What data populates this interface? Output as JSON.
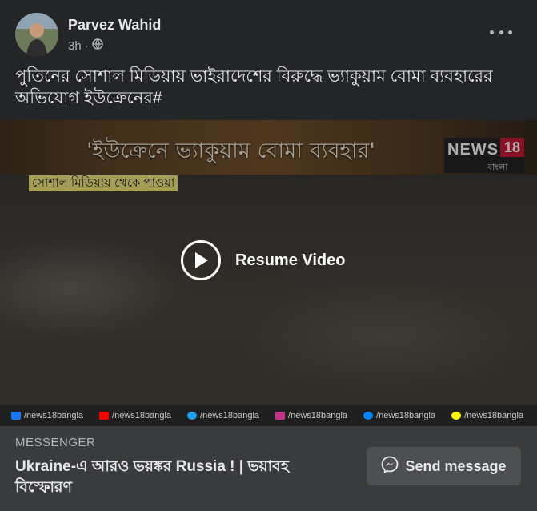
{
  "post": {
    "author": "Parvez Wahid",
    "time": "3h",
    "dot": "·",
    "text": "পুতিনের সোশাল মিডিয়ায় ভাইরাদেশের বিরুদ্ধে ভ্যাকুয়াম বোমা ব্যবহারের অভিযোগ ইউক্রেনের#"
  },
  "video": {
    "banner_title": "'ইউক্রেনে ভ্যাকুয়াম বোমা ব্যবহার'",
    "channel_word": "NEWS",
    "channel_number": "18",
    "channel_sub": "বাংলা",
    "source_label": "সোশাল মিডিয়ায় থেকে পাওয়া",
    "resume_label": "Resume Video",
    "social_handles": [
      {
        "icon": "facebook-icon",
        "color": "#1877f2",
        "handle": "/news18bangla"
      },
      {
        "icon": "youtube-icon",
        "color": "#ff0000",
        "handle": "/news18bangla"
      },
      {
        "icon": "twitter-icon",
        "color": "#1da1f2",
        "handle": "/news18bangla"
      },
      {
        "icon": "instagram-icon",
        "color": "#c13584",
        "handle": "/news18bangla"
      },
      {
        "icon": "messenger-icon",
        "color": "#0084ff",
        "handle": "/news18bangla"
      },
      {
        "icon": "snapchat-icon",
        "color": "#fffc00",
        "handle": "/news18bangla"
      }
    ]
  },
  "link_card": {
    "domain": "MESSENGER",
    "title": "Ukraine-এ আরও ভয়ঙ্কর Russia ! | ভয়াবহ বিস্ফোরণ",
    "button_label": "Send message"
  },
  "colors": {
    "background": "#242526",
    "card": "#3a3b3c",
    "accent_red": "#c8102e",
    "label_yellow": "#f1e97a"
  }
}
